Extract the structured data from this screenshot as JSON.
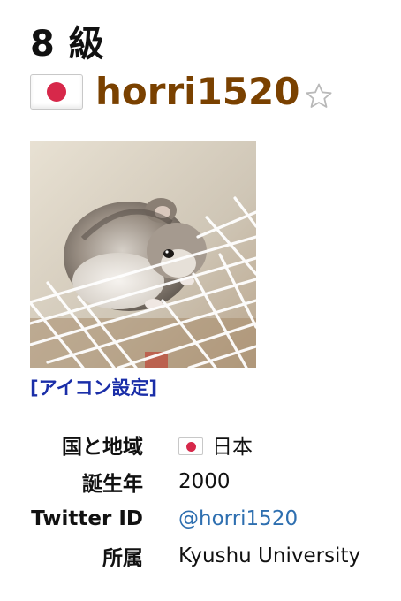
{
  "profile": {
    "rank": "8 級",
    "username": "horri1520",
    "favorite_icon": "star-outline-icon",
    "country_flag": "japan-flag-icon",
    "avatar": "hamster-avatar-image",
    "icon_settings_link": "[アイコン設定]"
  },
  "info": {
    "rows": [
      {
        "label": "国と地域",
        "value": "日本"
      },
      {
        "label": "誕生年",
        "value": "2000"
      },
      {
        "label": "Twitter ID",
        "value": "@horri1520"
      },
      {
        "label": "所属",
        "value": "Kyushu University"
      }
    ]
  },
  "colors": {
    "username": "#7a4100",
    "link": "#1a2ea8",
    "twitter": "#2e6fb0",
    "flag_red": "#d7284a"
  }
}
